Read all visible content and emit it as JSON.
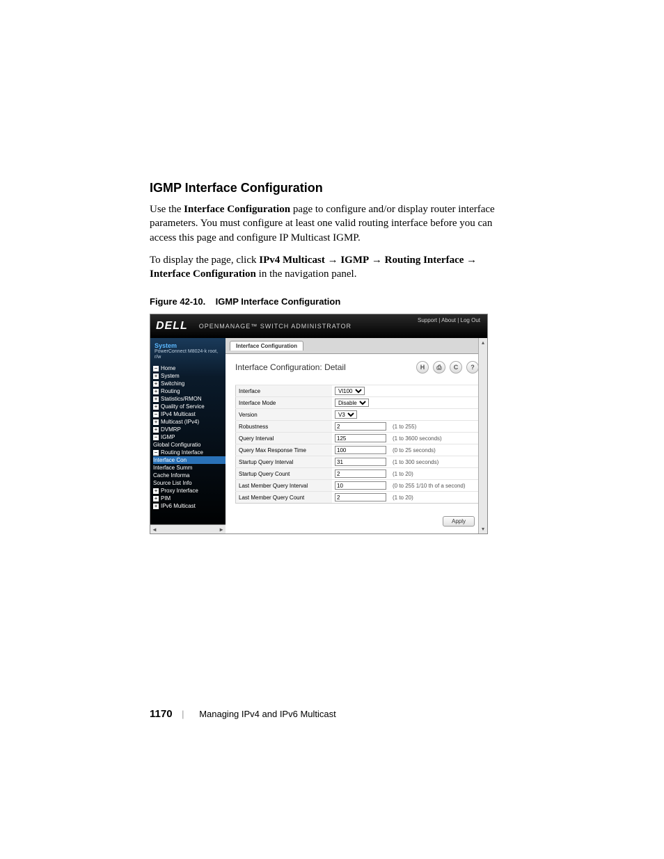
{
  "section_title": "IGMP Interface Configuration",
  "para1_pre": "Use the ",
  "para1_bold": "Interface Configuration",
  "para1_post": " page to configure and/or display router interface parameters. You must configure at least one valid routing interface before you can access this page and configure IP Multicast IGMP.",
  "para2_pre": "To display the page, click ",
  "para2_b1": "IPv4 Multicast",
  "para2_b2": "IGMP",
  "para2_b3": "Routing Interface",
  "para2_b4": "Interface Configuration",
  "para2_post": " in the navigation panel.",
  "fig_label": "Figure 42-10.",
  "fig_title": "IGMP Interface Configuration",
  "shot": {
    "logo": "DELL",
    "banner": "OPENMANAGE™ SWITCH ADMINISTRATOR",
    "toplinks": "Support  |  About  |  Log Out",
    "sys": "System",
    "sys_sub": "PowerConnect M8024-k\nroot, r/w",
    "tree": {
      "home": "Home",
      "system": "System",
      "switching": "Switching",
      "routing": "Routing",
      "stats": "Statistics/RMON",
      "qos": "Quality of Service",
      "ipv4m": "IPv4 Multicast",
      "multicast": "Multicast (IPv4)",
      "dvmrp": "DVMRP",
      "igmp": "IGMP",
      "globalcfg": "Global Configuratio",
      "ri": "Routing Interface",
      "ifconf": "Interface Con",
      "ifsumm": "Interface Summ",
      "cache": "Cache Informa",
      "srclist": "Source List Info",
      "proxy": "Proxy Interface",
      "pim": "PIM",
      "ipv6m": "IPv6 Multicast"
    },
    "tab": "Interface Configuration",
    "detail_title": "Interface Configuration: Detail",
    "rows": [
      {
        "label": "Interface",
        "type": "select",
        "value": "Vl100",
        "hint": ""
      },
      {
        "label": "Interface Mode",
        "type": "select",
        "value": "Disable",
        "hint": ""
      },
      {
        "label": "Version",
        "type": "select",
        "value": "V3",
        "hint": ""
      },
      {
        "label": "Robustness",
        "type": "input",
        "value": "2",
        "hint": "(1 to 255)"
      },
      {
        "label": "Query Interval",
        "type": "input",
        "value": "125",
        "hint": "(1 to 3600 seconds)"
      },
      {
        "label": "Query Max Response Time",
        "type": "input",
        "value": "100",
        "hint": "(0 to 25 seconds)"
      },
      {
        "label": "Startup Query Interval",
        "type": "input",
        "value": "31",
        "hint": "(1 to 300 seconds)"
      },
      {
        "label": "Startup Query Count",
        "type": "input",
        "value": "2",
        "hint": "(1 to 20)"
      },
      {
        "label": "Last Member Query Interval",
        "type": "input",
        "value": "10",
        "hint": "(0 to 255 1/10 th of a second)"
      },
      {
        "label": "Last Member Query Count",
        "type": "input",
        "value": "2",
        "hint": "(1 to 20)"
      }
    ],
    "apply": "Apply",
    "icons": {
      "save": "H",
      "print": "⎙",
      "refresh": "C",
      "help": "?"
    }
  },
  "footer": {
    "page": "1170",
    "chapter": "Managing IPv4 and IPv6 Multicast"
  }
}
